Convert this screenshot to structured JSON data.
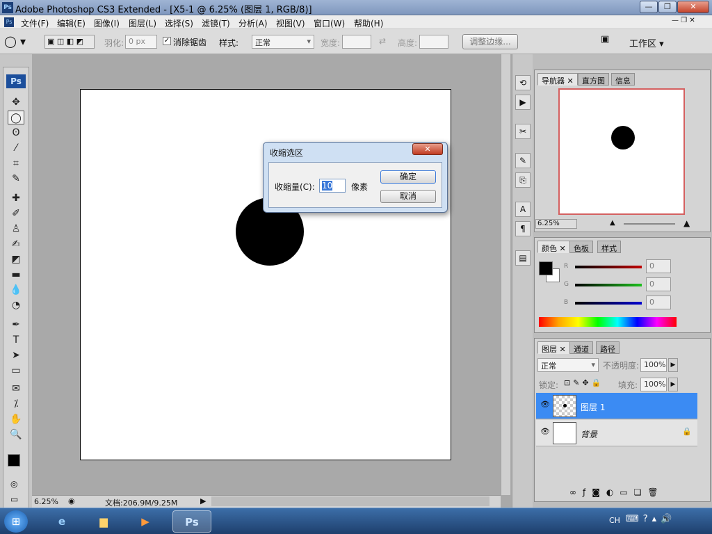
{
  "window": {
    "title": "Adobe Photoshop CS3 Extended - [X5-1 @ 6.25% (图层 1, RGB/8)]",
    "app_badge": "Ps"
  },
  "menu": [
    "文件(F)",
    "编辑(E)",
    "图像(I)",
    "图层(L)",
    "选择(S)",
    "滤镜(T)",
    "分析(A)",
    "视图(V)",
    "窗口(W)",
    "帮助(H)"
  ],
  "options": {
    "feather_label": "羽化:",
    "feather_value": "0 px",
    "antialias_label": "消除锯齿",
    "antialias_checked": true,
    "style_label": "样式:",
    "style_value": "正常",
    "width_label": "宽度:",
    "height_label": "高度:",
    "refine_button": "调整边缘...",
    "workspace": "工作区 ▾"
  },
  "tools": [
    {
      "icon": "move-icon",
      "g": "✥"
    },
    {
      "icon": "elliptical-marquee-icon",
      "g": "◯"
    },
    {
      "icon": "lasso-icon",
      "g": "ʘ"
    },
    {
      "icon": "magic-wand-icon",
      "g": "⁄"
    },
    {
      "icon": "crop-icon",
      "g": "⌗"
    },
    {
      "icon": "slice-icon",
      "g": "✎"
    },
    {
      "icon": "healing-brush-icon",
      "g": "✚"
    },
    {
      "icon": "brush-icon",
      "g": "✐"
    },
    {
      "icon": "clone-stamp-icon",
      "g": "♙"
    },
    {
      "icon": "history-brush-icon",
      "g": "✍"
    },
    {
      "icon": "eraser-icon",
      "g": "◩"
    },
    {
      "icon": "gradient-icon",
      "g": "▬"
    },
    {
      "icon": "blur-icon",
      "g": "💧"
    },
    {
      "icon": "dodge-icon",
      "g": "◔"
    },
    {
      "icon": "pen-icon",
      "g": "✒"
    },
    {
      "icon": "type-icon",
      "g": "T"
    },
    {
      "icon": "path-select-icon",
      "g": "➤"
    },
    {
      "icon": "shape-icon",
      "g": "▭"
    },
    {
      "icon": "notes-icon",
      "g": "✉"
    },
    {
      "icon": "eyedropper-icon",
      "g": "⁒"
    },
    {
      "icon": "hand-icon",
      "g": "✋"
    },
    {
      "icon": "zoom-icon",
      "g": "🔍"
    }
  ],
  "status": {
    "zoom": "6.25%",
    "doc": "文档:206.9M/9.25M"
  },
  "navigator": {
    "tabs": [
      "导航器",
      "直方图",
      "信息"
    ],
    "zoom": "6.25%"
  },
  "color": {
    "tabs": [
      "颜色",
      "色板",
      "样式"
    ],
    "channels": [
      {
        "label": "R",
        "value": "0",
        "color": "#c00000"
      },
      {
        "label": "G",
        "value": "0",
        "color": "#1ec01e"
      },
      {
        "label": "B",
        "value": "0",
        "color": "#0000d0"
      }
    ]
  },
  "layers": {
    "tabs": [
      "图层",
      "通道",
      "路径"
    ],
    "blend": "正常",
    "opacity_label": "不透明度:",
    "opacity": "100%",
    "lock_label": "锁定:",
    "fill_label": "填充:",
    "fill": "100%",
    "items": [
      {
        "name": "图层 1",
        "selected": true
      },
      {
        "name": "背景",
        "selected": false
      }
    ]
  },
  "dialog": {
    "title": "收缩选区",
    "label": "收缩量(C):",
    "value": "10",
    "unit": "像素",
    "ok": "确定",
    "cancel": "取消"
  },
  "taskbar": {
    "lang": "CH"
  }
}
